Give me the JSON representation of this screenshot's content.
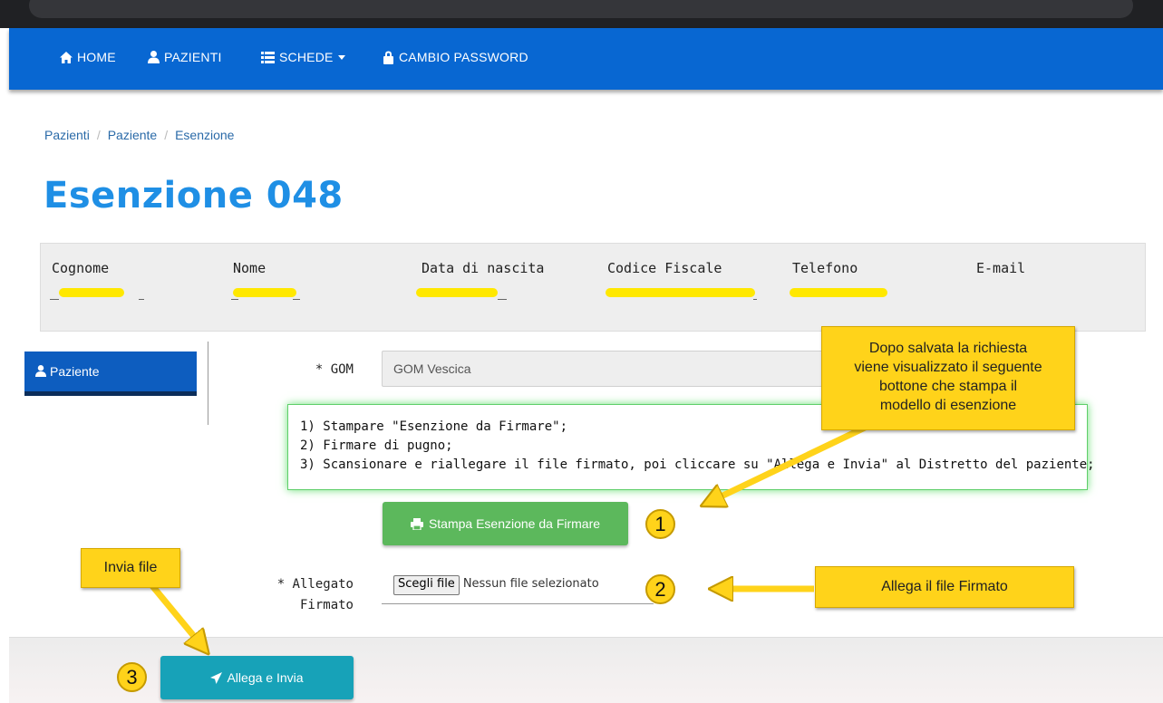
{
  "nav": {
    "home": "HOME",
    "pazienti": "PAZIENTI",
    "schede": "SCHEDE",
    "cambio_password": "CAMBIO PASSWORD"
  },
  "breadcrumb": [
    "Pazienti",
    "Paziente",
    "Esenzione"
  ],
  "page_title": "Esenzione 048",
  "patient": {
    "headers": [
      "Cognome",
      "Nome",
      "Data di nascita",
      "Codice Fiscale",
      "Telefono",
      "E-mail"
    ]
  },
  "sidebar": {
    "paziente": "Paziente"
  },
  "form": {
    "gom_label": "* GOM",
    "gom_value": "GOM Vescica",
    "instructions": [
      "1) Stampare \"Esenzione da Firmare\";",
      "2) Firmare di pugno;",
      "3) Scansionare e riallegare il file firmato, poi cliccare su \"Allega e Invia\" al Distretto del paziente;"
    ],
    "stampa_button": "Stampa Esenzione da Firmare",
    "allegato_label_1": "* Allegato",
    "allegato_label_2": "Firmato",
    "choose_file": "Scegli file",
    "no_file": "Nessun file selezionato"
  },
  "footer": {
    "allega_button": "Allega e Invia"
  },
  "annotations": {
    "callout_top": [
      "Dopo salvata la richiesta",
      "viene visualizzato il seguente",
      "bottone che stampa il",
      "modello di esenzione"
    ],
    "callout_invia": "Invia file",
    "callout_allega": "Allega il file Firmato",
    "step1": "1",
    "step2": "2",
    "step3": "3"
  },
  "colors": {
    "navbar": "#0867d2",
    "title": "#1f8fe5",
    "stampa_button": "#5cb85c",
    "allega_button": "#17a2b8",
    "callout": "#ffd31a",
    "redaction": "#ffe800"
  }
}
